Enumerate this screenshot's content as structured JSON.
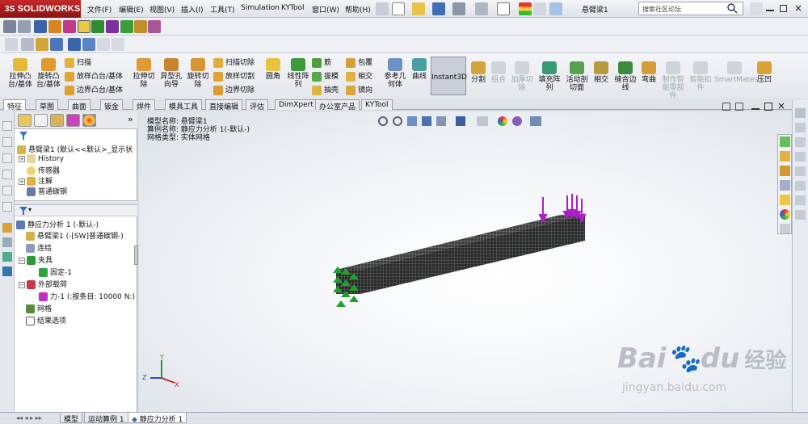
{
  "app": {
    "logo": "SOLIDWORKS",
    "logo_prefix": "3S",
    "document_name": "悬臂梁1"
  },
  "menu": [
    "文件(F)",
    "编辑(E)",
    "视图(V)",
    "插入(I)",
    "工具(T)",
    "Simulation",
    "KYTool",
    "窗口(W)",
    "帮助(H)"
  ],
  "search": {
    "placeholder": "搜索社区论坛"
  },
  "command_manager": {
    "extrude_boss": "拉伸凸\n台/基体",
    "revolve_boss": "旋转凸\n台/基体",
    "sweep": "扫描",
    "loft_boss": "放样凸台/基体",
    "boundary_boss": "边界凸台/基体",
    "extrude_cut": "拉伸切\n除",
    "hole_wizard": "异型孔\n向导",
    "revolve_cut": "旋转切\n除",
    "swept_cut": "扫描切除",
    "lofted_cut": "放样切割",
    "boundary_cut": "边界切除",
    "fillet": "圆角",
    "linear_pattern": "线性阵\n列",
    "rib": "筋",
    "draft": "拔模",
    "shell": "抽壳",
    "wrap": "包覆",
    "intersect": "相交",
    "mirror": "镜向",
    "ref_geometry": "参考几\n何体",
    "curves": "曲线",
    "instant3d": "Instant3D",
    "split": "分割",
    "combine": "组合",
    "thicken_cut": "加厚切\n除",
    "fill_pattern": "填充阵\n列",
    "live_section": "活动剖\n切面",
    "intersect2": "相交",
    "jog_edges": "缝合边\n线",
    "flex": "弯曲",
    "smart_fastener": "制作智\n能零部\n件",
    "smart_fasteners": "智能扣\n件",
    "smartmates": "SmartMates",
    "indent": "压凹"
  },
  "tabs": [
    "特征",
    "草图",
    "曲面",
    "钣金",
    "焊件",
    "模具工具",
    "直接编辑",
    "评估",
    "DimXpert",
    "办公室产品",
    "KYTool"
  ],
  "feature_tree": {
    "part": "悬臂梁1 (默认<<默认>_显示状",
    "items": [
      "History",
      "传感器",
      "注解",
      "普通碳钢"
    ]
  },
  "sim_tree": {
    "study": "静应力分析 1 (-默认-)",
    "part": "悬臂梁1 (-[SW]普通碳钢-)",
    "connections": "连结",
    "fixtures": "夹具",
    "fixed": "固定-1",
    "loads": "外部载荷",
    "force": "力-1 (:按条目: 10000 N:)",
    "mesh": "网格",
    "result_options": "结果选项"
  },
  "viewport": {
    "model_name": "模型名称: 悬臂梁1",
    "study_name": "算例名称: 静应力分析 1(-默认-)",
    "mesh_type": "网格类型: 实体网格",
    "axis_x": "X",
    "axis_y": "Y",
    "axis_z": "Z"
  },
  "bottom_tabs": [
    "模型",
    "运动算例 1",
    "静应力分析 1"
  ],
  "watermark": {
    "brand": "Bai",
    "brand2": "du",
    "jingyan": "经验",
    "url": "jingyan.baidu.com"
  },
  "colors": {
    "logo_red": "#b51f1f",
    "mesh": "#2a2a2a",
    "fixture_green": "#1fa12a",
    "load_magenta": "#b01cc8"
  }
}
